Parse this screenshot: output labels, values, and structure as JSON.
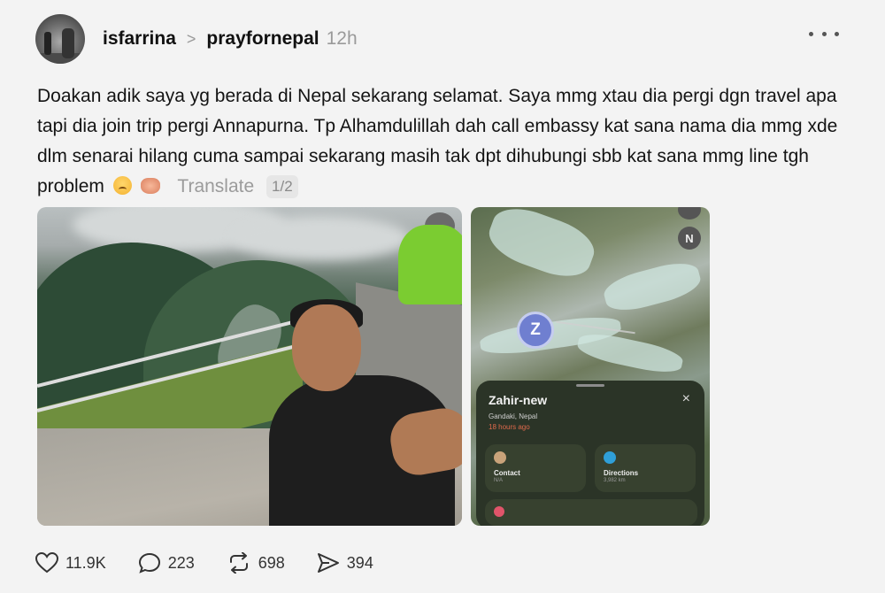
{
  "post": {
    "username": "isfarrina",
    "tag": "prayfornepal",
    "time": "12h",
    "separator": ">",
    "body_text": "Doakan adik saya yg berada di Nepal sekarang selamat. Saya mmg xtau dia pergi dgn travel apa tapi dia join trip pergi Annapurna. Tp Alhamdulillah dah call embassy kat sana nama dia mmg xde dlm senarai hilang cuma sampai sekarang masih tak dpt dihubungi sbb kat sana mmg line tgh problem",
    "emojis": [
      "sad-face-emoji",
      "pleading-hands-emoji"
    ],
    "translate_label": "Translate",
    "page_indicator": "1/2"
  },
  "map_card": {
    "compass_label": "N",
    "pin_letter": "Z",
    "name": "Zahir-new",
    "location": "Gandaki, Nepal",
    "updated": "18 hours ago",
    "close_label": "×",
    "contact_label": "Contact",
    "contact_sub": "N/A",
    "directions_label": "Directions",
    "directions_sub": "3,982 km"
  },
  "stats": {
    "likes": "11.9K",
    "comments": "223",
    "reposts": "698",
    "shares": "394"
  },
  "colors": {
    "background": "#f3f3f3",
    "text": "#141414",
    "muted": "#9b9b9b",
    "pin": "#6f7fd0",
    "card": "#2b3427"
  }
}
